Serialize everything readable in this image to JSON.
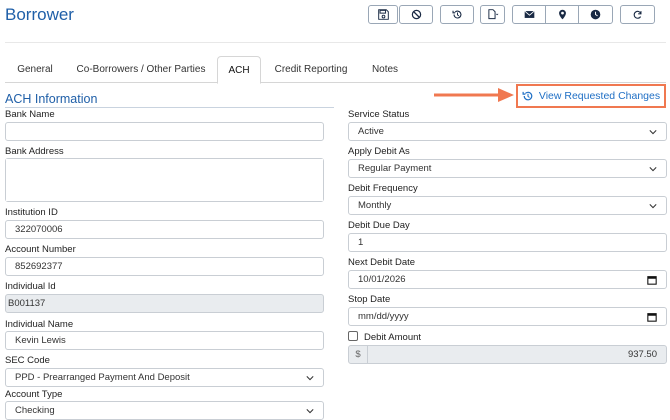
{
  "page": {
    "title": "Borrower"
  },
  "toolbar": {
    "buttons": [
      {
        "name": "save-icon"
      },
      {
        "name": "cancel-icon"
      },
      {
        "name": "history-icon"
      },
      {
        "name": "document-dropdown-icon"
      },
      {
        "name": "envelope-icon"
      },
      {
        "name": "map-marker-icon"
      },
      {
        "name": "clock-icon"
      },
      {
        "name": "refresh-icon"
      }
    ]
  },
  "tabs": [
    {
      "label": "General"
    },
    {
      "label": "Co-Borrowers / Other Parties"
    },
    {
      "label": "ACH"
    },
    {
      "label": "Credit Reporting"
    },
    {
      "label": "Notes"
    }
  ],
  "active_tab": "ACH",
  "section": {
    "title": "ACH Information"
  },
  "view_requested_changes": {
    "label": "View Requested Changes"
  },
  "colors": {
    "accent": "#1f5fa8",
    "link": "#1f6fc5",
    "highlight": "#f07850"
  },
  "left_fields": {
    "bank_name": {
      "label": "Bank Name",
      "value": ""
    },
    "bank_address": {
      "label": "Bank Address",
      "value": ""
    },
    "institution_id": {
      "label": "Institution ID",
      "value": "322070006"
    },
    "account_number": {
      "label": "Account Number",
      "value": "852692377"
    },
    "individual_id": {
      "label": "Individual Id",
      "value": "B001137"
    },
    "individual_name": {
      "label": "Individual Name",
      "value": "Kevin Lewis"
    },
    "sec_code": {
      "label": "SEC Code",
      "value": "PPD - Prearranged Payment And Deposit"
    },
    "account_type": {
      "label": "Account Type",
      "value": "Checking"
    }
  },
  "right_fields": {
    "service_status": {
      "label": "Service Status",
      "value": "Active"
    },
    "apply_debit_as": {
      "label": "Apply Debit As",
      "value": "Regular Payment"
    },
    "debit_frequency": {
      "label": "Debit Frequency",
      "value": "Monthly"
    },
    "debit_due_day": {
      "label": "Debit Due Day",
      "value": "1"
    },
    "next_debit_date": {
      "label": "Next Debit Date",
      "value": "10/01/2026"
    },
    "stop_date": {
      "label": "Stop Date",
      "value": "mm/dd/yyyy"
    },
    "debit_amount": {
      "label": "Debit Amount",
      "currency": "$",
      "value": "937.50",
      "checked": false
    }
  }
}
